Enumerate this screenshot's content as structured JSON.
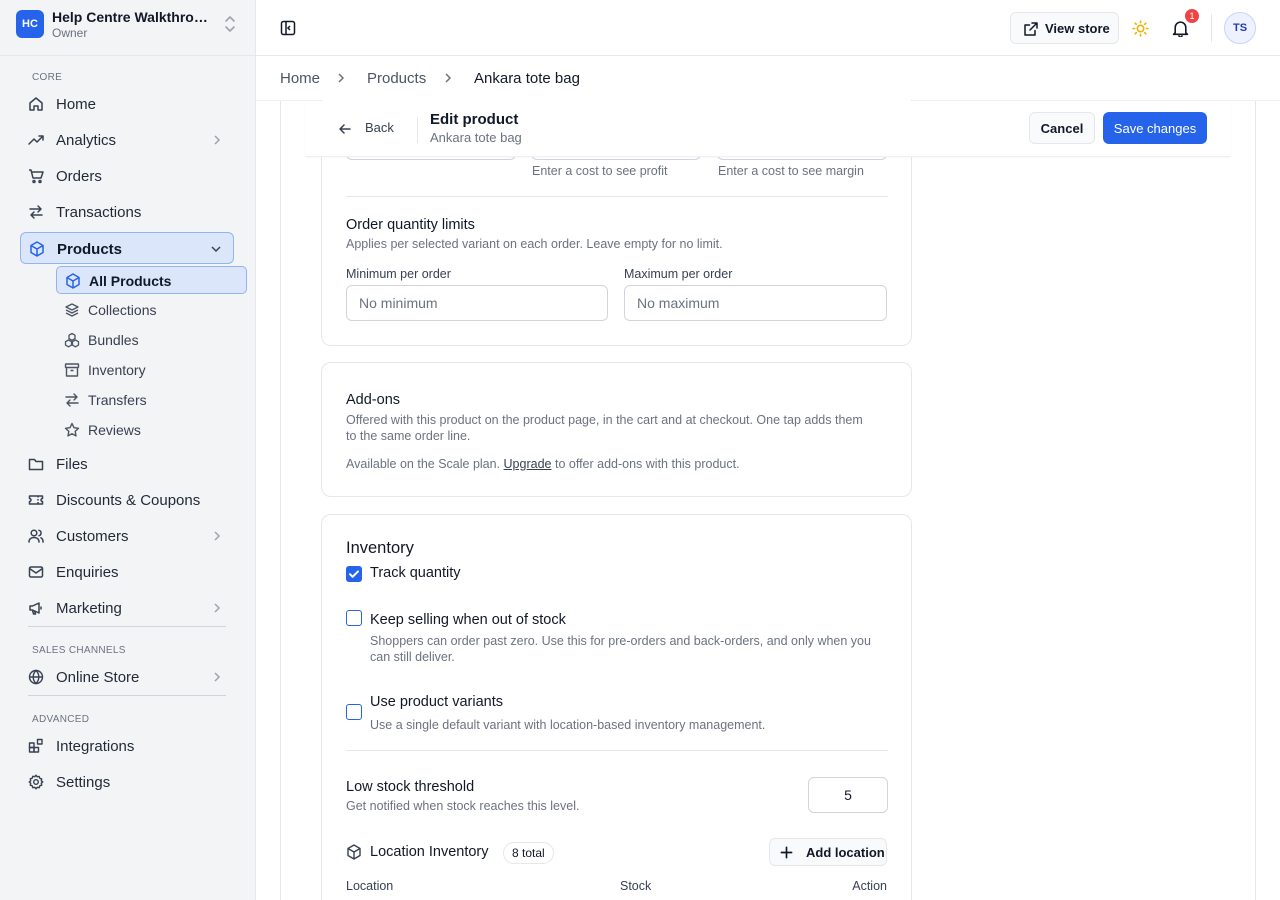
{
  "workspace": {
    "badge": "HC",
    "name": "Help Centre Walkthrough",
    "role": "Owner"
  },
  "sidebar": {
    "core_label": "CORE",
    "home": "Home",
    "analytics": "Analytics",
    "orders": "Orders",
    "transactions": "Transactions",
    "products": "Products",
    "products_sub": {
      "all": "All Products",
      "collections": "Collections",
      "bundles": "Bundles",
      "inventory": "Inventory",
      "transfers": "Transfers",
      "reviews": "Reviews"
    },
    "files": "Files",
    "discounts": "Discounts & Coupons",
    "customers": "Customers",
    "enquiries": "Enquiries",
    "marketing": "Marketing",
    "sales_label": "SALES CHANNELS",
    "online_store": "Online Store",
    "advanced_label": "ADVANCED",
    "integrations": "Integrations",
    "settings": "Settings"
  },
  "topbar": {
    "view_store": "View store",
    "notif_count": "1",
    "avatar": "TS"
  },
  "breadcrumb": {
    "home": "Home",
    "products": "Products",
    "current": "Ankara tote bag"
  },
  "editbar": {
    "back": "Back",
    "title": "Edit product",
    "subtitle": "Ankara tote bag",
    "cancel": "Cancel",
    "save": "Save changes"
  },
  "pricing": {
    "profit_hint": "Enter a cost to see profit",
    "margin_hint": "Enter a cost to see margin"
  },
  "order_limits": {
    "title": "Order quantity limits",
    "help": "Applies per selected variant on each order. Leave empty for no limit.",
    "min_label": "Minimum per order",
    "min_placeholder": "No minimum",
    "max_label": "Maximum per order",
    "max_placeholder": "No maximum"
  },
  "addons": {
    "title": "Add-ons",
    "desc1": "Offered with this product on the product page, in the cart and at checkout. One tap adds them",
    "desc2": "to the same order line.",
    "plan_pre": "Available on the Scale plan.",
    "plan_link": "Upgrade",
    "plan_post": "to offer add-ons with this product."
  },
  "inventory": {
    "title": "Inventory",
    "track": "Track quantity",
    "keep": "Keep selling when out of stock",
    "keep_help1": "Shoppers can order past zero. Use this for pre-orders and back-orders, and only when you",
    "keep_help2": "can still deliver.",
    "variants": "Use product variants",
    "variants_help": "Use a single default variant with location-based inventory management.",
    "low_title": "Low stock threshold",
    "low_help": "Get notified when stock reaches this level.",
    "low_value": "5",
    "loc_title": "Location Inventory",
    "loc_badge": "8 total",
    "add_location": "Add location",
    "col_location": "Location",
    "col_stock": "Stock",
    "col_action": "Action"
  },
  "colors": {
    "accent": "#2563eb",
    "badge": "#ef4444",
    "sun": "#eab308"
  }
}
